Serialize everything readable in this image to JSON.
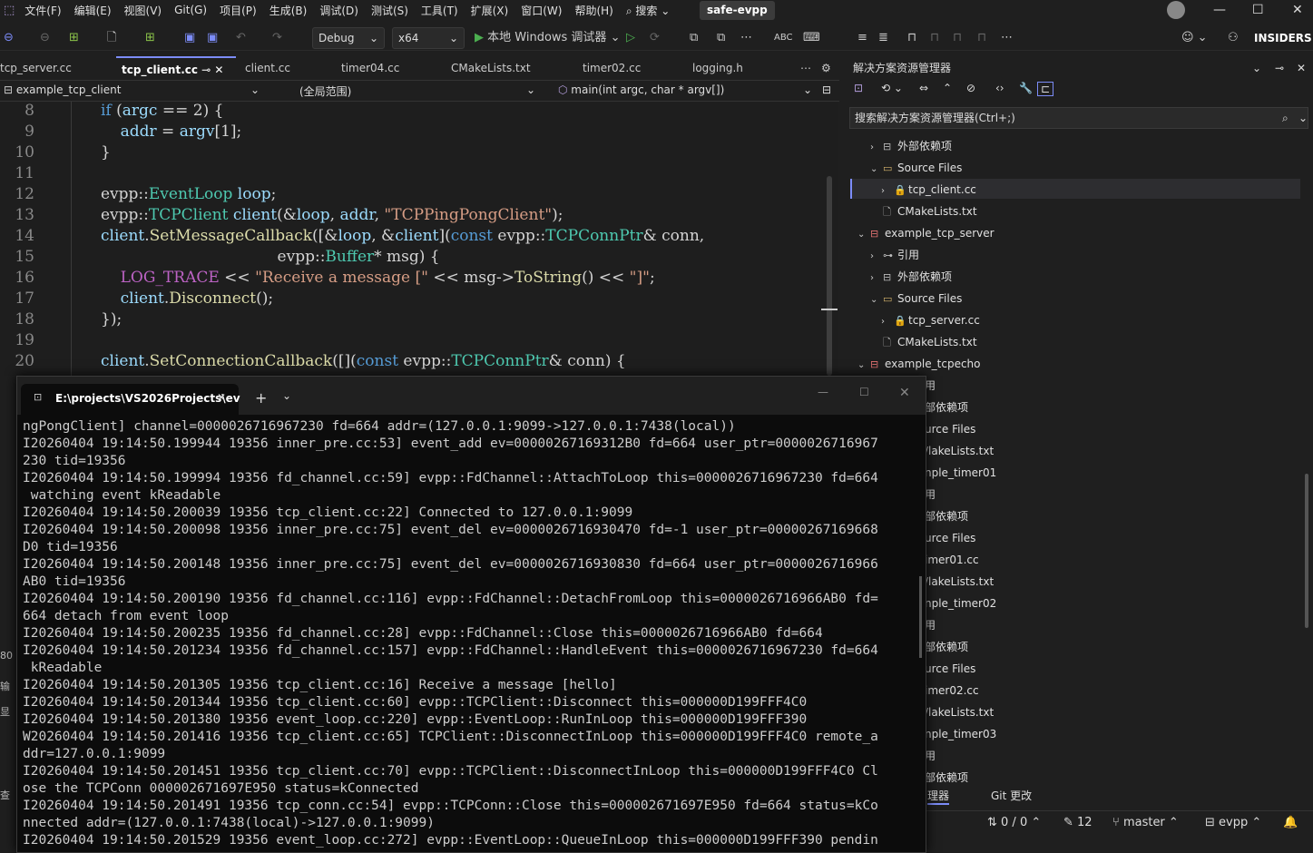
{
  "menu": {
    "items": [
      "文件(F)",
      "编辑(E)",
      "视图(V)",
      "Git(G)",
      "项目(P)",
      "生成(B)",
      "调试(D)",
      "测试(S)",
      "工具(T)",
      "扩展(X)",
      "窗口(W)",
      "帮助(H)"
    ],
    "search_label": "搜索",
    "solution_name": "safe-evpp"
  },
  "toolbar": {
    "config": "Debug",
    "platform": "x64",
    "run_label": "本地 Windows 调试器",
    "insiders": "INSIDERS"
  },
  "tabs": [
    "tcp_server.cc",
    "tcp_client.cc",
    "client.cc",
    "timer04.cc",
    "CMakeLists.txt",
    "timer02.cc",
    "logging.h"
  ],
  "navbar": {
    "project": "example_tcp_client",
    "scope": "(全局范围)",
    "member": "main(int argc, char * argv[])"
  },
  "editor": {
    "line_numbers": [
      "8",
      "9",
      "10",
      "11",
      "12",
      "13",
      "14",
      "15",
      "16",
      "17",
      "18",
      "19",
      "20"
    ]
  },
  "solution_explorer": {
    "title": "解决方案资源管理器",
    "search_placeholder": "搜索解决方案资源管理器(Ctrl+;)",
    "items": [
      {
        "label": "外部依赖项"
      },
      {
        "label": "Source Files"
      },
      {
        "label": "tcp_client.cc"
      },
      {
        "label": "CMakeLists.txt"
      },
      {
        "label": "example_tcp_server"
      },
      {
        "label": "引用"
      },
      {
        "label": "外部依赖项"
      },
      {
        "label": "Source Files"
      },
      {
        "label": "tcp_server.cc"
      },
      {
        "label": "CMakeLists.txt"
      },
      {
        "label": "example_tcpecho"
      }
    ],
    "partial_items": [
      "用",
      "部依赖项",
      "urce Files",
      "/lakeLists.txt",
      "nple_timer01",
      "用",
      "部依赖项",
      "urce Files",
      "imer01.cc",
      "/lakeLists.txt",
      "nple_timer02",
      "用",
      "部依赖项",
      "urce Files",
      "imer02.cc",
      "/lakeLists.txt",
      "nple_timer03",
      "用",
      "部依赖项"
    ]
  },
  "bottom_tabs": {
    "left": "理器",
    "git": "Git 更改"
  },
  "status": {
    "sync": "0 / 0",
    "edits": "12",
    "branch": "master",
    "repo": "evpp"
  },
  "terminal": {
    "title": "E:\\projects\\VS2026Projects\\ev",
    "lines": [
      "ngPongClient] channel=0000026716967230 fd=664 addr=(127.0.0.1:9099->127.0.0.1:7438(local))",
      "I20260404 19:14:50.199944 19356 inner_pre.cc:53] event_add ev=00000267169312B0 fd=664 user_ptr=0000026716967",
      "230 tid=19356",
      "I20260404 19:14:50.199994 19356 fd_channel.cc:59] evpp::FdChannel::AttachToLoop this=0000026716967230 fd=664",
      " watching event kReadable",
      "I20260404 19:14:50.200039 19356 tcp_client.cc:22] Connected to 127.0.0.1:9099",
      "I20260404 19:14:50.200098 19356 inner_pre.cc:75] event_del ev=0000026716930470 fd=-1 user_ptr=00000267169668",
      "D0 tid=19356",
      "I20260404 19:14:50.200148 19356 inner_pre.cc:75] event_del ev=0000026716930830 fd=664 user_ptr=0000026716966",
      "AB0 tid=19356",
      "I20260404 19:14:50.200190 19356 fd_channel.cc:116] evpp::FdChannel::DetachFromLoop this=0000026716966AB0 fd=",
      "664 detach from event loop",
      "I20260404 19:14:50.200235 19356 fd_channel.cc:28] evpp::FdChannel::Close this=0000026716966AB0 fd=664",
      "I20260404 19:14:50.201234 19356 fd_channel.cc:157] evpp::FdChannel::HandleEvent this=0000026716967230 fd=664",
      " kReadable",
      "I20260404 19:14:50.201305 19356 tcp_client.cc:16] Receive a message [hello]",
      "I20260404 19:14:50.201344 19356 tcp_client.cc:60] evpp::TCPClient::Disconnect this=000000D199FFF4C0",
      "I20260404 19:14:50.201380 19356 event_loop.cc:220] evpp::EventLoop::RunInLoop this=000000D199FFF390",
      "W20260404 19:14:50.201416 19356 tcp_client.cc:65] TCPClient::DisconnectInLoop this=000000D199FFF4C0 remote_a",
      "ddr=127.0.0.1:9099",
      "I20260404 19:14:50.201451 19356 tcp_client.cc:70] evpp::TCPClient::DisconnectInLoop this=000000D199FFF4C0 Cl",
      "ose the TCPConn 000002671697E950 status=kConnected",
      "I20260404 19:14:50.201491 19356 tcp_conn.cc:54] evpp::TCPConn::Close this=000002671697E950 fd=664 status=kCo",
      "nnected addr=(127.0.0.1:7438(local)->127.0.0.1:9099)",
      "I20260404 19:14:50.201529 19356 event_loop.cc:272] evpp::EventLoop::QueueInLoop this=000000D199FFF390 pendin"
    ]
  }
}
